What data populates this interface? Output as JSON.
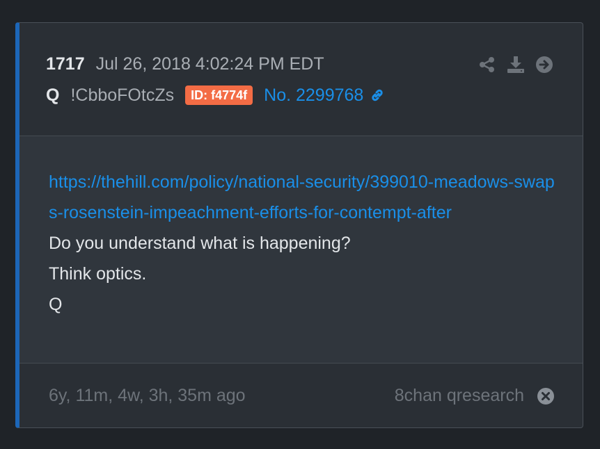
{
  "post": {
    "number": "1717",
    "date": "Jul 26, 2018 4:02:24 PM EDT",
    "author": "Q",
    "tripcode": "!CbboFOtcZs",
    "id_badge": "ID: f4774f",
    "post_link": "No. 2299768",
    "actions": [
      "share-icon",
      "download-icon",
      "arrow-right-icon"
    ]
  },
  "body": {
    "url": "https://thehill.com/policy/national-security/399010-meadows-swaps-rosenstein-impeachment-efforts-for-contempt-after",
    "lines": [
      "Do you understand what is happening?",
      "Think optics.",
      "Q"
    ]
  },
  "footer": {
    "ago": "6y, 11m, 4w, 3h, 35m ago",
    "source": "8chan qresearch"
  },
  "colors": {
    "accent": "#1c66b8",
    "link": "#1a8fe8",
    "badge": "#f36c45"
  }
}
